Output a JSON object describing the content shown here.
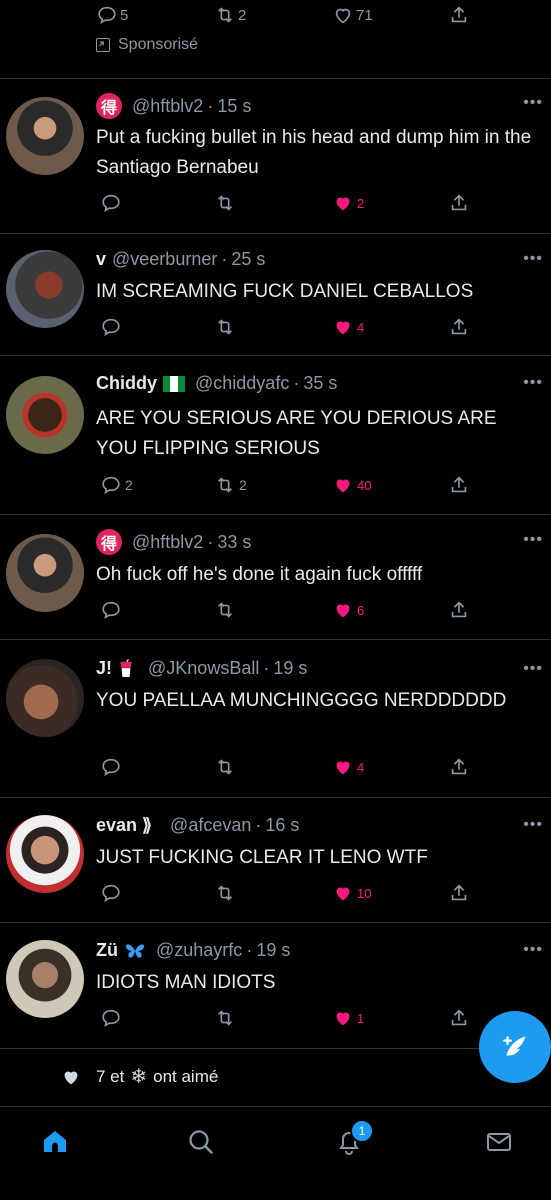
{
  "top_actions": {
    "replies": "5",
    "retweets": "2",
    "likes": "71",
    "promoted_label": "Sponsorisé"
  },
  "tweets": [
    {
      "name": "",
      "badge": "得",
      "handle": "@hftblv2",
      "sep": "·",
      "time": "15 s",
      "text": "Put a fucking bullet in his head and dump him in the Santiago Bernabeu",
      "replies": "",
      "retweets": "",
      "likes": "2"
    },
    {
      "name": "v",
      "handle": "@veerburner",
      "sep": "·",
      "time": "25 s",
      "text": "IM SCREAMING FUCK DANIEL CEBALLOS",
      "replies": "",
      "retweets": "",
      "likes": "4"
    },
    {
      "name": "Chiddy",
      "handle": "@chiddyafc",
      "sep": "·",
      "time": "35 s",
      "text": "ARE YOU SERIOUS ARE YOU DERIOUS ARE YOU FLIPPING SERIOUS",
      "replies": "2",
      "retweets": "2",
      "likes": "40"
    },
    {
      "name": "",
      "badge": "得",
      "handle": "@hftblv2",
      "sep": "·",
      "time": "33 s",
      "text": "Oh fuck off he's done it again fuck offfff",
      "replies": "",
      "retweets": "",
      "likes": "6"
    },
    {
      "name": "J!",
      "handle": "@JKnowsBall",
      "sep": "·",
      "time": "19 s",
      "text": "YOU PAELLAA MUNCHINGGGG NERDDDDDD",
      "replies": "",
      "retweets": "",
      "likes": "4"
    },
    {
      "name": "evan ⟫",
      "handle": "@afcevan",
      "sep": "·",
      "time": "16 s",
      "text": "JUST FUCKING CLEAR IT LENO WTF",
      "replies": "",
      "retweets": "",
      "likes": "10"
    },
    {
      "name": "Zü",
      "handle": "@zuhayrfc",
      "sep": "·",
      "time": "19 s",
      "text": "IDIOTS MAN IDIOTS",
      "replies": "",
      "retweets": "",
      "likes": "1"
    }
  ],
  "liked_row": {
    "text_a": "7 et",
    "text_b": "ont aimé"
  },
  "nav": {
    "notif_count": "1"
  },
  "colors": {
    "accent": "#1d9bf0",
    "like": "#f91880",
    "muted": "#8b98a5",
    "background": "#000000"
  }
}
